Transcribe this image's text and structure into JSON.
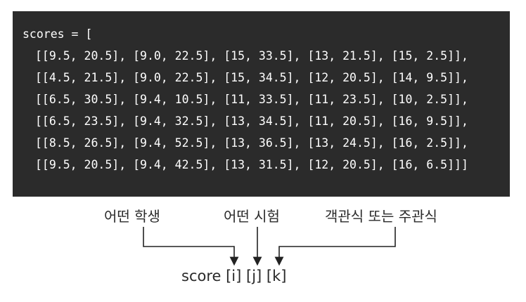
{
  "code": {
    "header": "scores = [",
    "rows": [
      "[[9.5, 20.5], [9.0, 22.5], [15, 33.5], [13, 21.5], [15, 2.5]],",
      "[[4.5, 21.5], [9.0, 22.5], [15, 34.5], [12, 20.5], [14, 9.5]],",
      "[[6.5, 30.5], [9.4, 10.5], [11, 33.5], [11, 23.5], [10, 2.5]],",
      "[[6.5, 23.5], [9.4, 32.5], [13, 34.5], [11, 20.5], [16, 9.5]],",
      "[[8.5, 26.5], [9.4, 52.5], [13, 36.5], [13, 24.5], [16, 2.5]],",
      "[[9.5, 20.5], [9.4, 42.5], [13, 31.5], [12, 20.5], [16, 6.5]]]"
    ]
  },
  "labels": {
    "i": "어떤 학생",
    "j": "어떤 시험",
    "k": "객관식 또는 주관식"
  },
  "expression": "score [i] [j] [k]"
}
